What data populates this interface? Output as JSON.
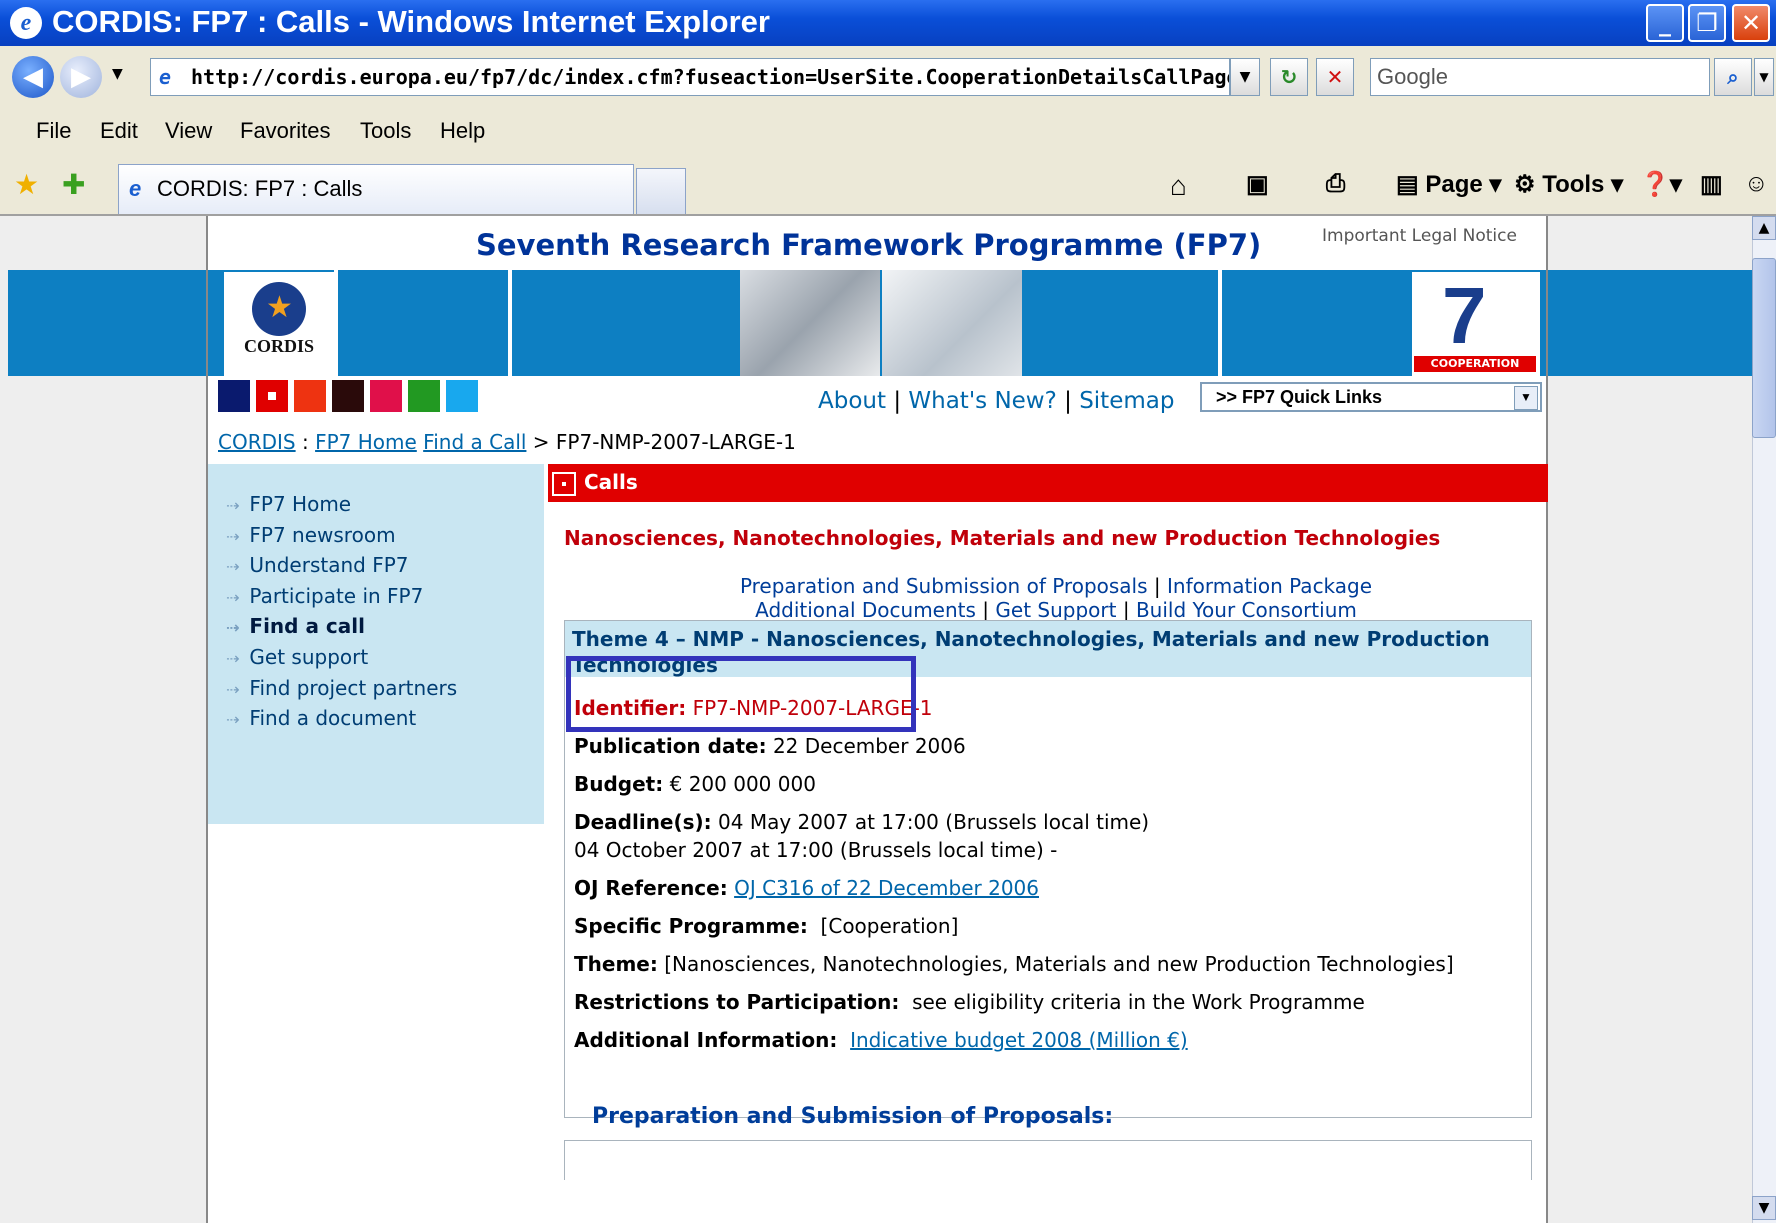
{
  "window": {
    "title": "CORDIS: FP7 : Calls - Windows Internet Explorer",
    "minimize": "_",
    "restore": "❐",
    "close": "✕"
  },
  "addressbar": {
    "url": "http://cordis.europa.eu/fp7/dc/index.cfm?fuseaction=UserSite.CooperationDetailsCallPage&c",
    "search_placeholder": "Google"
  },
  "menu": [
    "File",
    "Edit",
    "View",
    "Favorites",
    "Tools",
    "Help"
  ],
  "tab": {
    "label": "CORDIS: FP7 : Calls"
  },
  "toolbar": {
    "page_label": "Page",
    "tools_label": "Tools"
  },
  "site": {
    "title": "Seventh Research Framework Programme (FP7)",
    "legal_notice": "Important Legal Notice",
    "cordis_logo": "CORDIS",
    "coop_logo": "COOPERATION",
    "color_squares": [
      "#0a1a6e",
      "#e00000",
      "#ee3311",
      "#2a0a0a",
      "#e0104a",
      "#229922",
      "#18a8ee"
    ],
    "top_links": {
      "about": "About",
      "whats_new": "What's New?",
      "sitemap": "Sitemap"
    },
    "quick_links": ">> FP7 Quick Links"
  },
  "breadcrumb": {
    "cordis": "CORDIS",
    "sep1": ":",
    "fp7_home": "FP7 Home",
    "find_call": "Find a Call",
    "sep2": ">",
    "current": "FP7-NMP-2007-LARGE-1"
  },
  "leftnav": [
    {
      "label": "FP7 Home",
      "bold": false
    },
    {
      "label": "FP7 newsroom",
      "bold": false
    },
    {
      "label": "Understand FP7",
      "bold": false
    },
    {
      "label": "Participate in FP7",
      "bold": false
    },
    {
      "label": "Find a call",
      "bold": true
    },
    {
      "label": "Get support",
      "bold": false
    },
    {
      "label": "Find project partners",
      "bold": false
    },
    {
      "label": "Find a document",
      "bold": false
    }
  ],
  "calls": {
    "header": "Calls",
    "area_title": "Nanosciences, Nanotechnologies, Materials and new Production Technologies",
    "links_line1": {
      "a": "Preparation and Submission of Proposals",
      "b": "Information Package"
    },
    "links_line2": {
      "a": "Additional Documents",
      "b": "Get Support",
      "c": "Build Your Consortium"
    },
    "theme": "Theme 4 – NMP - Nanosciences, Nanotechnologies, Materials and new Production Technologies",
    "identifier_label": "Identifier:",
    "identifier": "FP7-NMP-2007-LARGE-1",
    "publication_label": "Publication date:",
    "publication": "22 December 2006",
    "budget_label": "Budget:",
    "budget": "€ 200 000 000",
    "deadline_label": "Deadline(s):",
    "deadline1": "04 May 2007 at 17:00 (Brussels local time)",
    "deadline2": "04 October 2007 at 17:00 (Brussels local time) -",
    "oj_label": "OJ Reference:",
    "oj": "OJ C316 of 22 December 2006",
    "programme_label": "Specific Programme:",
    "programme": "[Cooperation]",
    "theme_label": "Theme:",
    "theme_value": "[Nanosciences, Nanotechnologies, Materials and new Production Technologies]",
    "restrictions_label": "Restrictions to Participation:",
    "restrictions": "see eligibility criteria in the Work Programme",
    "additional_label": "Additional Information:",
    "additional": "Indicative budget 2008 (Million €)",
    "prep_heading": "Preparation and Submission of Proposals:"
  }
}
